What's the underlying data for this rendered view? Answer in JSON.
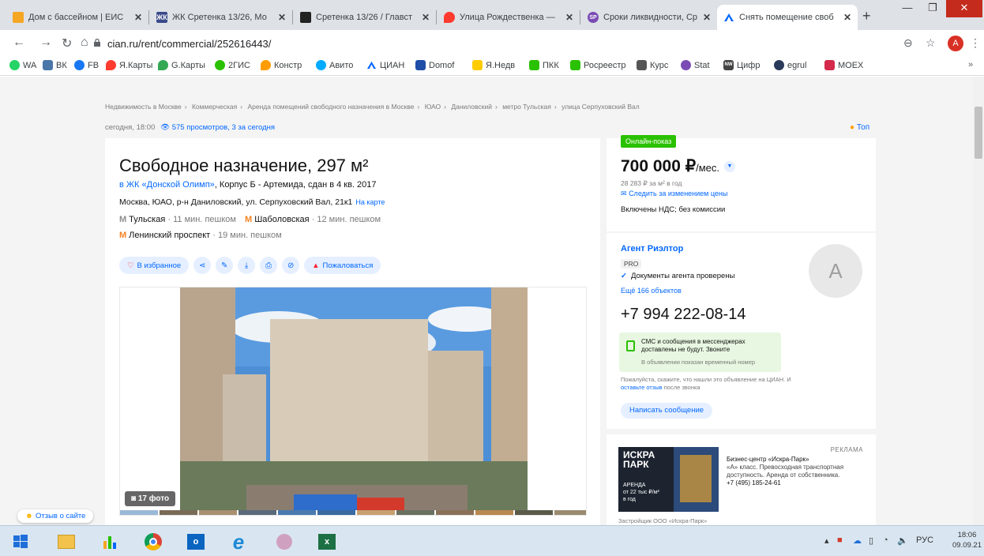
{
  "browser": {
    "tabs": [
      {
        "title": "Дом с бассейном | ЕИС",
        "color": "#f5a623",
        "glyph": ""
      },
      {
        "title": "ЖК Сретенка 13/26, Мо",
        "color": "#3a4a8a",
        "glyph": "ЖК"
      },
      {
        "title": "Сретенка 13/26 / Главст",
        "color": "#222222",
        "glyph": ""
      },
      {
        "title": "Улица Рождественка —",
        "color": "#ff3b30",
        "glyph": ""
      },
      {
        "title": "Сроки ликвидности, Ср",
        "color": "#7a4bb5",
        "glyph": "SP"
      },
      {
        "title": "Снять помещение своб",
        "color": "#0468ff",
        "glyph": ""
      }
    ],
    "active_tab_index": 5,
    "url": "cian.ru/rent/commercial/252616443/",
    "profile_initial": "A",
    "bookmarks": [
      {
        "label": "WA",
        "color": "#25d366"
      },
      {
        "label": "ВК",
        "color": "#4a76a8"
      },
      {
        "label": "FB",
        "color": "#1877f2"
      },
      {
        "label": "Я.Карты",
        "color": "#ff3b30"
      },
      {
        "label": "G.Карты",
        "color": "#34a853"
      },
      {
        "label": "2ГИС",
        "color": "#2ac100"
      },
      {
        "label": "Констр",
        "color": "#ff9d00"
      },
      {
        "label": "Авито",
        "color": "#00aaff"
      },
      {
        "label": "ЦИАН",
        "color": "#0468ff"
      },
      {
        "label": "Domof",
        "color": "#1f4ea8"
      },
      {
        "label": "Я.Недв",
        "color": "#ffcc00"
      },
      {
        "label": "ПКК",
        "color": "#2ac100"
      },
      {
        "label": "Росреестр",
        "color": "#2ac100"
      },
      {
        "label": "Курс",
        "color": "#555555"
      },
      {
        "label": "Stat",
        "color": "#7a4bb5"
      },
      {
        "label": "Цифр",
        "color": "#444444"
      },
      {
        "label": "egrul",
        "color": "#2a3a5a"
      },
      {
        "label": "MOEX",
        "color": "#d42a4b"
      }
    ]
  },
  "page": {
    "breadcrumbs": [
      "Недвижимость в Москве",
      "Коммерческая",
      "Аренда помещений свободного назначения в Москве",
      "ЮАО",
      "Даниловский",
      "метро Тульская",
      "улица Серпуховский Вал"
    ],
    "published": "сегодня, 18:00",
    "views": "575 просмотров, 3 за сегодня",
    "top_badge": "Топ",
    "title": "Свободное назначение, 297 м²",
    "complex_link": "в ЖК «Донской Олимп»",
    "complex_rest": ", Корпус Б - Артемида, сдан в 4 кв. 2017",
    "address": "Москва, ЮАО, р-н Даниловский, ул. Серпуховский Вал, 21к1",
    "map_link": "На карте",
    "metro": [
      {
        "name": "Тульская",
        "dist": "· 11 мин. пешком",
        "color": "#8d8d8d"
      },
      {
        "name": "Шаболовская",
        "dist": "· 12 мин. пешком",
        "color": "#f58220"
      },
      {
        "name": "Ленинский проспект",
        "dist": "· 19 мин. пешком",
        "color": "#f58220"
      }
    ],
    "favorite": "В избранное",
    "complain": "Пожаловаться",
    "photo_count": "17 фото",
    "price_card": {
      "online": "Онлайн-показ",
      "price": "700 000 ₽",
      "per": "/мес.",
      "price_sqm": "28 283 ₽ за м² в год",
      "follow": "Следить за изменением цены",
      "vat": "Включены НДС; без комиссии"
    },
    "agent": {
      "name": "Агент Риэлтор",
      "pro": "PRO",
      "checked": "Документы агента проверены",
      "more": "Ещё 166 объектов",
      "avatar_initial": "A",
      "phone": "+7 994 222-08-14",
      "sms_line1": "СМС и сообщения в мессенджерах",
      "sms_line2": "доставлены не будут. Звоните",
      "sms_note": "В объявлении показан временный номер",
      "feedback_pre": "Пожалуйста, скажите, что нашли это объявление на ЦИАН. И",
      "feedback_link": "оставьте отзыв",
      "feedback_post": "после звонка",
      "write": "Написать сообщение"
    },
    "ad": {
      "label": "РЕКЛАМА",
      "logo_line1": "ИСКРА",
      "logo_line2": "ПАРК",
      "logo_sub1": "АРЕНДА",
      "logo_sub2": "от 22 тыс ₽/м²",
      "logo_sub3": "в год",
      "title": "Бизнес-центр «Искра-Парк»",
      "desc": "«А» класс. Превосходная транспортная доступность. Аренда от собственника.",
      "phone": "+7 (495) 185-24-61",
      "developer": "Застройщик ООО «Искра-Парк»"
    },
    "feedback_pill": "Отзыв о сайте"
  },
  "taskbar": {
    "lang": "РУС",
    "time": "18:06",
    "date": "09.09.21"
  }
}
